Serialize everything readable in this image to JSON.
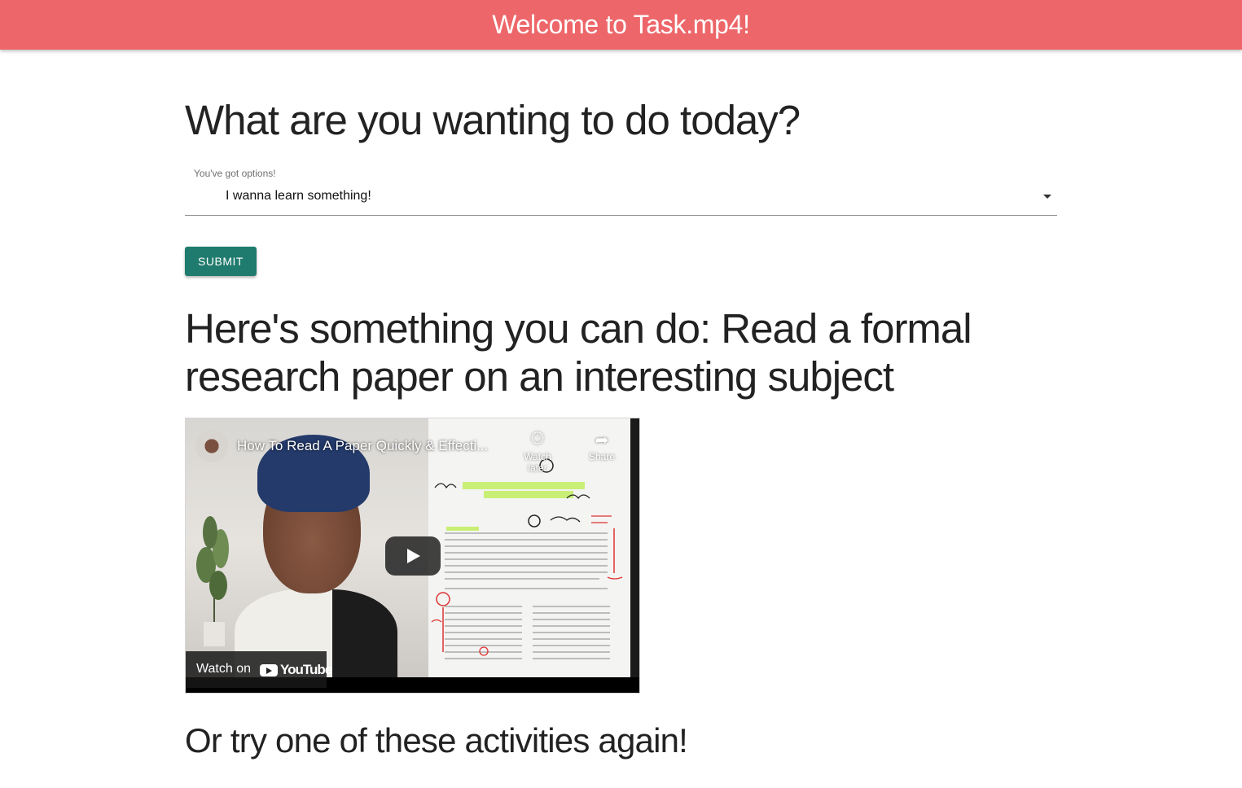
{
  "appbar": {
    "title": "Welcome to Task.mp4!"
  },
  "main": {
    "question": "What are you wanting to do today?",
    "select": {
      "label": "You've got options!",
      "value": "I wanna learn something!"
    },
    "submit_label": "SUBMIT",
    "suggestion": "Here's something you can do: Read a formal research paper on an interesting subject",
    "video": {
      "title": "How To Read A Paper Quickly & Effecti...",
      "watch_later_label": "Watch later",
      "share_label": "Share",
      "watch_on_label": "Watch on",
      "youtube_label": "YouTube"
    },
    "again_heading": "Or try one of these activities again!"
  }
}
